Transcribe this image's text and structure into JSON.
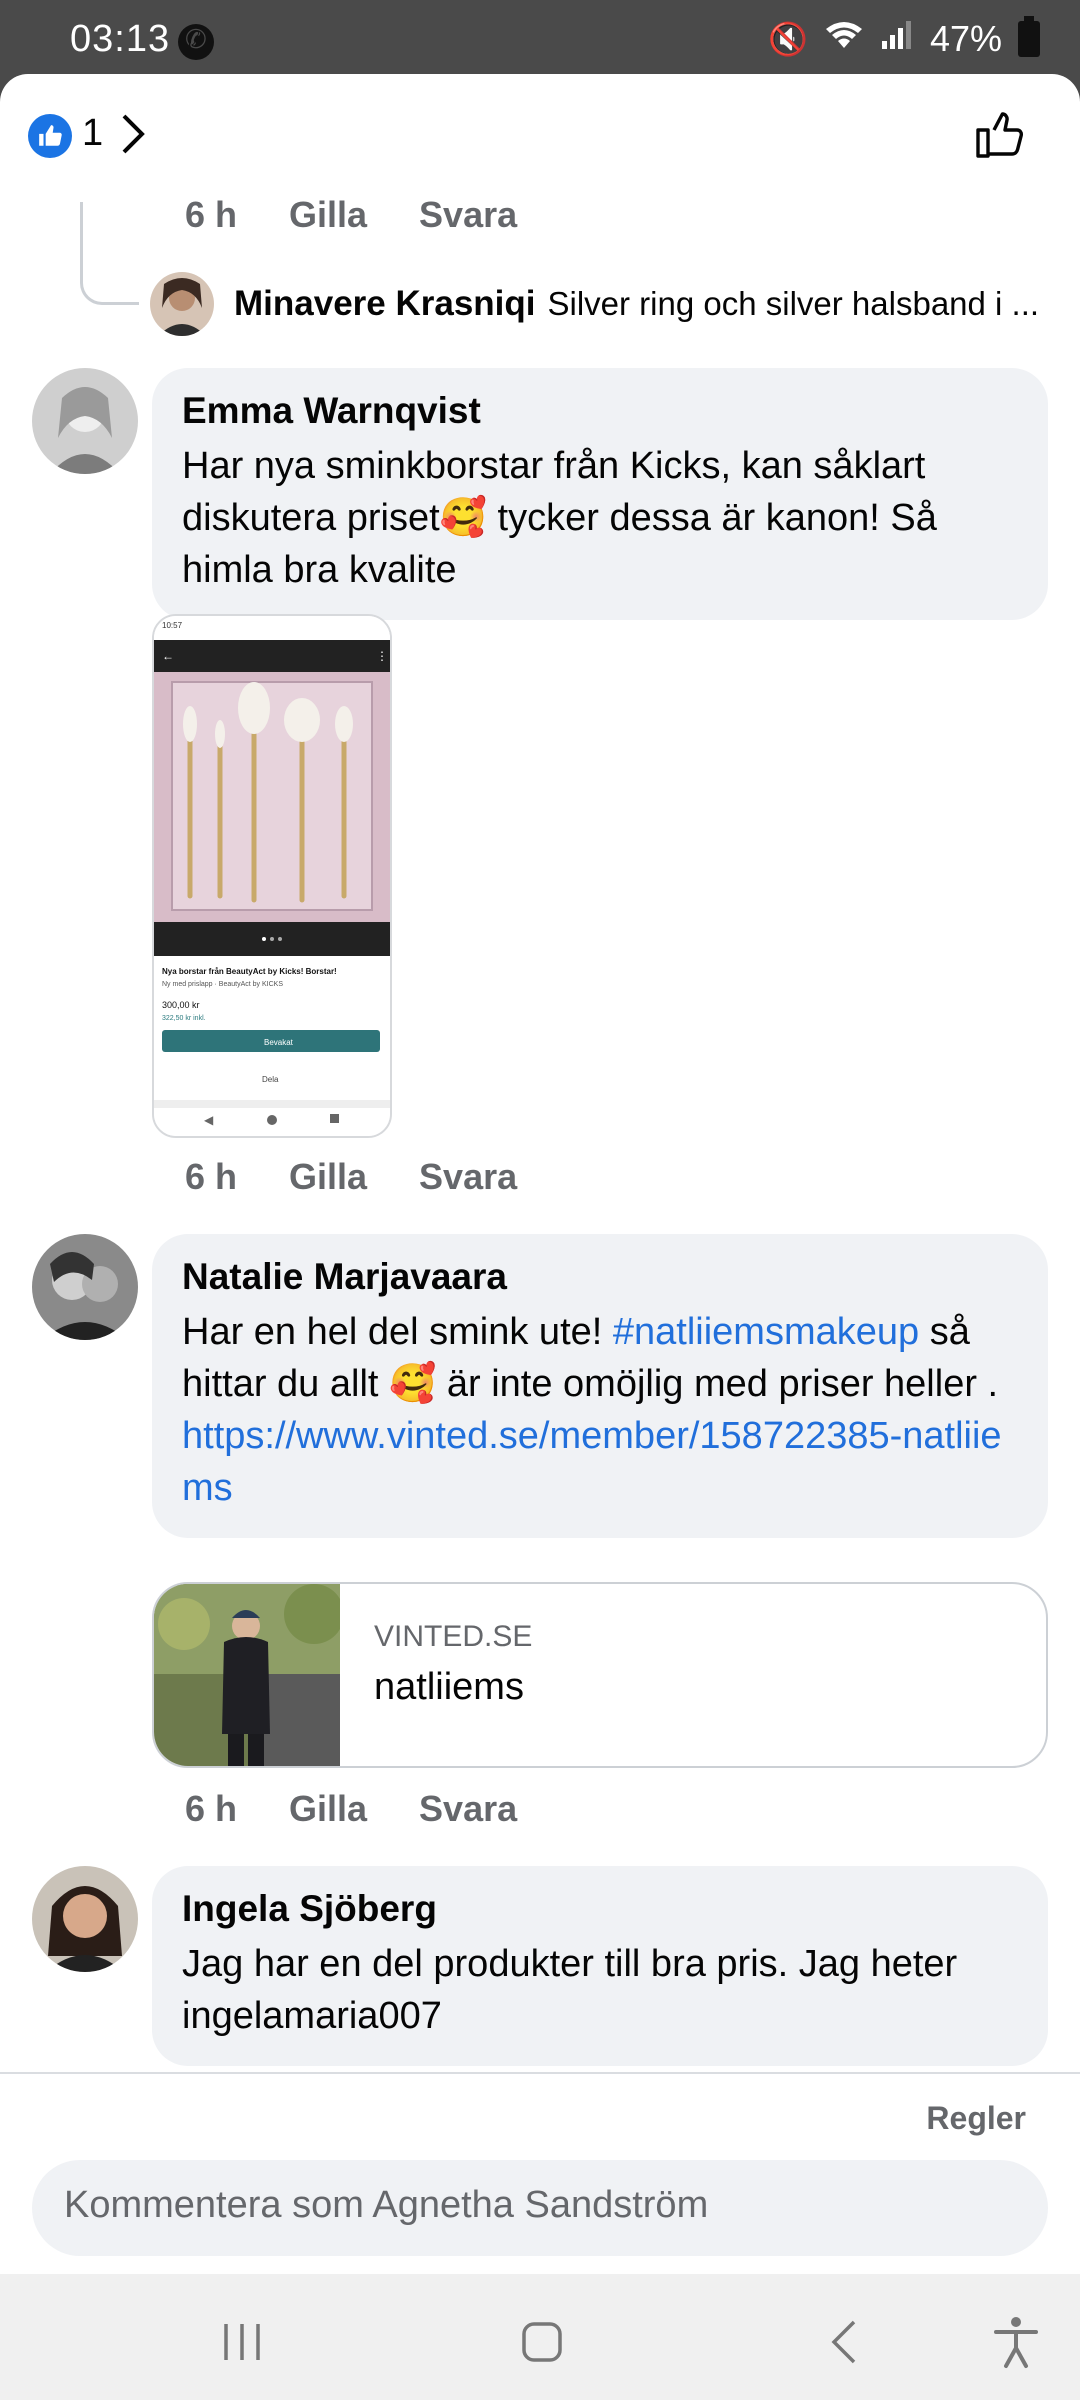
{
  "status_bar": {
    "time": "03:13",
    "battery": "47%"
  },
  "header": {
    "like_count": "1"
  },
  "reply": {
    "meta": {
      "time": "6 h",
      "like": "Gilla",
      "reply": "Svara"
    },
    "author": "Minavere Krasniqi",
    "snippet": "Silver ring och silver halsband i ..."
  },
  "comments": [
    {
      "author": "Emma Warnqvist",
      "text": "Har nya sminkborstar från Kicks, kan såklart diskutera priset🥰 tycker dessa är kanon! Så himla bra kvalite",
      "meta": {
        "time": "6 h",
        "like": "Gilla",
        "reply": "Svara"
      }
    },
    {
      "author": "Natalie Marjavaara",
      "text_before": "Har en hel del smink ute! ",
      "hashtag": "#natliiemsmakeup",
      "text_after": " så hittar du allt 🥰 är inte omöjlig med priser heller . ",
      "url": "https://www.vinted.se/member/158722385-natliiems",
      "link_card": {
        "domain": "VINTED.SE",
        "title": "natliiems"
      },
      "meta": {
        "time": "6 h",
        "like": "Gilla",
        "reply": "Svara"
      }
    },
    {
      "author": "Ingela Sjöberg",
      "text": "Jag har en del produkter till bra pris. Jag heter ingelamaria007"
    }
  ],
  "attachment_screenshot": {
    "title": "Nya borstar från BeautyAct by Kicks! Borstar!",
    "subtitle": "Ny med prislapp · BeautyAct by KICKS",
    "price": "300,00 kr",
    "price_incl": "322,50 kr inkl.",
    "buy_label": "Bevakat",
    "share_label": "Dela"
  },
  "footer": {
    "rules_label": "Regler",
    "composer_placeholder": "Kommentera som Agnetha Sandström"
  },
  "colors": {
    "link": "#216fdb",
    "like_blue": "#1b74e4",
    "bubble": "#f0f2f5"
  }
}
